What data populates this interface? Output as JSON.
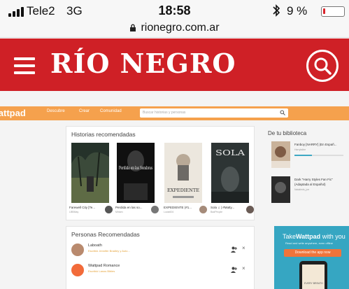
{
  "status_bar": {
    "carrier": "Tele2",
    "network": "3G",
    "time": "18:58",
    "bluetooth_icon": "bluetooth-icon",
    "battery_percent": "9 %",
    "battery_level": 0.09
  },
  "browser": {
    "url": "rionegro.com.ar"
  },
  "site_header": {
    "logo": "RÍO NEGRO",
    "brand_color": "#cf2026",
    "menu_icon": "hamburger-icon",
    "search_icon": "search-icon"
  },
  "wattpad": {
    "logo": "Wattpad",
    "nav": [
      "Descubre",
      "Crear",
      "Comunidad"
    ],
    "search_placeholder": "Buscar historias y personas",
    "accent_color": "#f5a14d",
    "recommended": {
      "title": "Historias recomendadas",
      "books": [
        {
          "title": "Farewell City [Te...",
          "author": "LBBMay",
          "cover_text": ""
        },
        {
          "title": "Perdida en las so...",
          "author": "Miriam",
          "cover_text": "Perdida en las Sombras"
        },
        {
          "title": "EXPEDIENTE (#1...",
          "author": "Lucia604",
          "cover_text": "EXPEDIENTE"
        },
        {
          "title": "Sola ♫ | #Matty...",
          "author": "BadPeople",
          "cover_text": "SOLA"
        }
      ]
    },
    "people": {
      "title": "Personas Recomendadas",
      "items": [
        {
          "name": "Laboath",
          "note": "Escribió Jennifer Bradley y Auto..."
        },
        {
          "name": "Wattpad Romance",
          "note": "Escribió Lanos Bibles"
        }
      ]
    },
    "library": {
      "title": "De tu biblioteca",
      "items": [
        {
          "title": "Fanboy [NARRY] (En Españ...",
          "author": "Harrylaltre",
          "progress": 0.35
        },
        {
          "title": "Dark \"Harry Styles Fan Fic\"",
          "subtitle": "(Adaptada al Español)",
          "author": "Natalieds_joe"
        }
      ]
    },
    "ad": {
      "title_plain": "Take",
      "title_brand": "Wattpad",
      "title_rest": "with you",
      "subtitle": "Read and write anywhere, even offline",
      "button": "Download the app now",
      "book_text": "EVERY BREATH"
    }
  }
}
